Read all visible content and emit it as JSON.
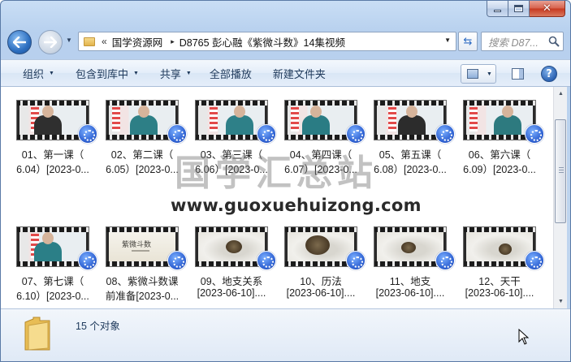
{
  "window": {
    "caption_buttons": {
      "minimize": "minimize",
      "maximize": "maximize",
      "close": "✕"
    }
  },
  "address": {
    "chevron": "«",
    "crumbs": [
      "国学资源网",
      "D8765 彭心融《紫微斗数》14集视频"
    ],
    "separator": "▸"
  },
  "search": {
    "placeholder": "搜索 D87..."
  },
  "toolbar": {
    "organize": "组织",
    "include_library": "包含到库中",
    "share": "共享",
    "play_all": "全部播放",
    "new_folder": "新建文件夹",
    "help": "?"
  },
  "files": [
    {
      "line1": "01、第一课（",
      "line2": "6.04）[2023-0...",
      "scene": "lecture",
      "shirt": "#2f2f2f"
    },
    {
      "line1": "02、第二课（",
      "line2": "6.05）[2023-0...",
      "scene": "lecture",
      "shirt": "#2d7f86"
    },
    {
      "line1": "03、第三课（",
      "line2": "6.06）[2023-0...",
      "scene": "lecture",
      "shirt": "#2e8088"
    },
    {
      "line1": "04、第四课（",
      "line2": "6.07）[2023-0...",
      "scene": "lecture",
      "shirt": "#2a7c84"
    },
    {
      "line1": "05、第五课（",
      "line2": "6.08）[2023-0...",
      "scene": "lecture",
      "shirt": "#2c2c2c"
    },
    {
      "line1": "06、第六课（",
      "line2": "6.09）[2023-0...",
      "scene": "lecture",
      "shirt": "#2d7a7f"
    },
    {
      "line1": "07、第七课（",
      "line2": "6.10）[2023-0...",
      "scene": "lecture",
      "shirt": "#2b7f87"
    },
    {
      "line1": "08、紫微斗数课",
      "line2": "前准备[2023-0...",
      "scene": "title",
      "title": "紫微斗数"
    },
    {
      "line1": "09、地支关系",
      "line2": "[2023-06-10]....",
      "scene": "ink"
    },
    {
      "line1": "10、历法",
      "line2": "[2023-06-10]....",
      "scene": "ink"
    },
    {
      "line1": "11、地支",
      "line2": "[2023-06-10]....",
      "scene": "ink"
    },
    {
      "line1": "12、天干",
      "line2": "[2023-06-10]....",
      "scene": "ink"
    }
  ],
  "watermark": {
    "text": "国学汇总站",
    "url": "www.guoxuehuizong.com"
  },
  "details": {
    "count": "15 个对象"
  },
  "colors": {
    "accent": "#2c63b3",
    "toolbar_text": "#1e395b",
    "video_badge": "#2c5fd1"
  }
}
